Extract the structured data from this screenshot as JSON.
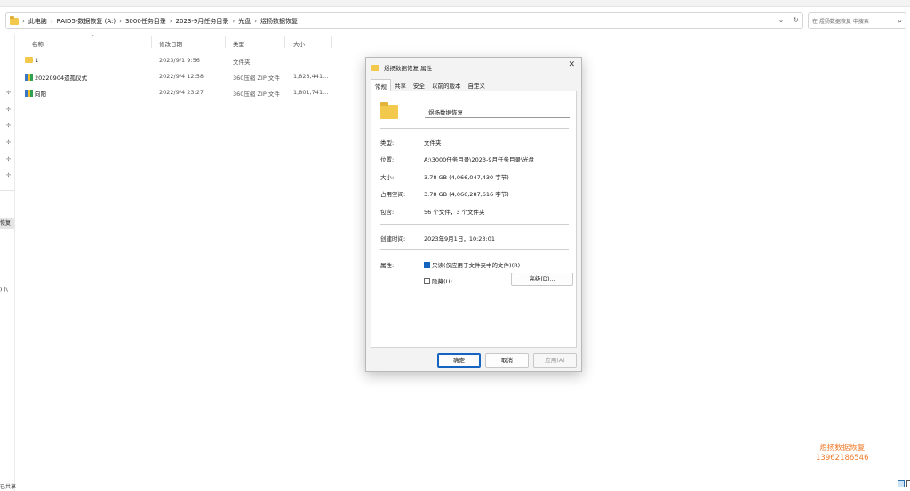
{
  "breadcrumb": [
    "此电脑",
    "RAID5-数据恢复 (A:)",
    "3000任务目录",
    "2023-9月任务目录",
    "光盘",
    "煜扬数据恢复"
  ],
  "search": {
    "placeholder": "在 煜扬数据恢复 中搜索"
  },
  "columns": {
    "name": "名称",
    "date": "修改日期",
    "type": "类型",
    "size": "大小"
  },
  "files": [
    {
      "name": "1",
      "date": "2023/9/1 9:56",
      "type": "文件夹",
      "size": "",
      "icon": "folder-icon"
    },
    {
      "name": "20220904遗孤仪式",
      "date": "2022/9/4 12:58",
      "type": "360压缩 ZIP 文件",
      "size": "1,823,441...",
      "icon": "zip-file-icon"
    },
    {
      "name": "向阳",
      "date": "2022/9/4 23:27",
      "type": "360压缩 ZIP 文件",
      "size": "1,801,741...",
      "icon": "zip-file-icon"
    }
  ],
  "nav": {
    "selected": "恢复",
    "fragment": ") (\\",
    "status": "已共享"
  },
  "dialog": {
    "title": "煜扬数据恢复 属性",
    "tabs": [
      "常规",
      "共享",
      "安全",
      "以前的版本",
      "自定义"
    ],
    "name_value": "煜扬数据恢复",
    "props": [
      {
        "label": "类型:",
        "value": "文件夹"
      },
      {
        "label": "位置:",
        "value": "A:\\3000任务目录\\2023-9月任务目录\\光盘"
      },
      {
        "label": "大小:",
        "value": "3.78 GB (4,066,047,430 字节)"
      },
      {
        "label": "占用空间:",
        "value": "3.78 GB (4,066,287,616 字节)"
      },
      {
        "label": "包含:",
        "value": "56 个文件，3 个文件夹"
      },
      {
        "label": "创建时间:",
        "value": "2023年9月1日，10:23:01"
      }
    ],
    "attr_label": "属性:",
    "readonly_label": "只读(仅应用于文件夹中的文件)(R)",
    "hidden_label": "隐藏(H)",
    "advanced_label": "高级(D)...",
    "ok_label": "确定",
    "cancel_label": "取消",
    "apply_label": "应用(A)"
  },
  "watermark": {
    "line1": "煜扬数据恢复",
    "line2": "13962186546"
  },
  "colors": {
    "accent": "#1565c0",
    "watermark": "#f07a2a",
    "folder": "#f2c94c"
  }
}
